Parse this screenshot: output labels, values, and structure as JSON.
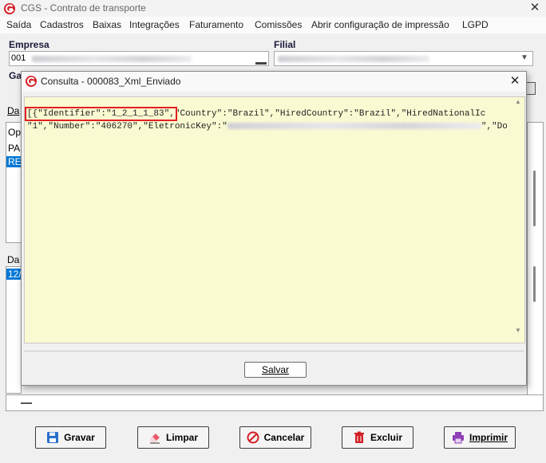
{
  "window": {
    "title": "CGS - Contrato de transporte",
    "close_glyph": "✕"
  },
  "menu": [
    "Saída",
    "Cadastros",
    "Baixas",
    "Integrações",
    "Faturamento",
    "Comissões",
    "Abrir configuração de impressão",
    "LGPD"
  ],
  "form": {
    "empresa_label": "Empresa",
    "empresa_code": "001",
    "filial_label": "Filial",
    "ga_label": "Ga",
    "da_label": "Da",
    "op_header": "Op",
    "list_row_1": "PA",
    "list_row_2": "RE",
    "da_label_2": "Da",
    "list2_row_1": "12/"
  },
  "dialog": {
    "title": "Consulta - 000083_Xml_Enviado",
    "close_glyph": "✕",
    "line1_highlight": "[{\"Identifier\":\"1_2_1_1_83\",",
    "line1_rest": "\"Country\":\"Brazil\",\"HiredCountry\":\"Brazil\",\"HiredNationalIc",
    "line2_start": "\"1\",\"Number\":\"406270\",\"EletronicKey\":\"",
    "line2_end": "\",\"Do",
    "save_label": "Salvar",
    "highlight_color": "#e02020"
  },
  "buttons": {
    "gravar": "Gravar",
    "limpar": "Limpar",
    "cancelar": "Cancelar",
    "excluir": "Excluir",
    "imprimir": "Imprimir"
  }
}
